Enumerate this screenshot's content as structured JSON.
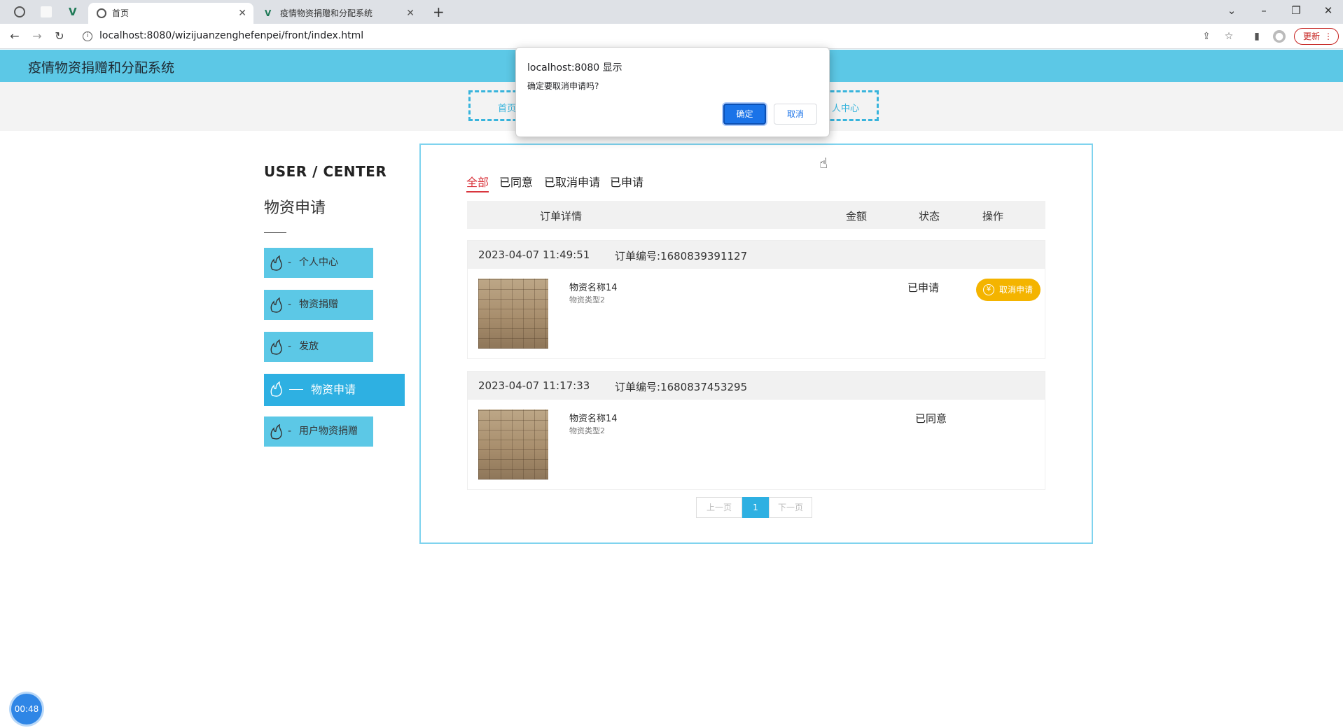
{
  "browser": {
    "tabs": [
      {
        "label": "首页",
        "active": true
      },
      {
        "label": "疫情物资捐赠和分配系统",
        "active": false
      }
    ],
    "url": "localhost:8080/wizijuanzenghefenpei/front/index.html",
    "update_label": "更新"
  },
  "site": {
    "title": "疫情物资捐赠和分配系统",
    "nav_left": "首页",
    "nav_right": "人中心"
  },
  "sidebar": {
    "title": "USER / CENTER",
    "subtitle": "物资申请",
    "items": [
      {
        "label": "个人中心"
      },
      {
        "label": "物资捐赠"
      },
      {
        "label": "发放"
      },
      {
        "label": "物资申请"
      },
      {
        "label": "用户物资捐赠"
      }
    ]
  },
  "filters": [
    "全部",
    "已同意",
    "已取消申请",
    "已申请"
  ],
  "table_headers": {
    "details": "订单详情",
    "amount": "金额",
    "status": "状态",
    "action": "操作"
  },
  "orders": [
    {
      "time": "2023-04-07 11:49:51",
      "order_no": "订单编号:1680839391127",
      "name": "物资名称14",
      "type": "物资类型2",
      "status": "已申请",
      "action": "取消申请"
    },
    {
      "time": "2023-04-07 11:17:33",
      "order_no": "订单编号:1680837453295",
      "name": "物资名称14",
      "type": "物资类型2",
      "status": "已同意"
    }
  ],
  "pagination": {
    "prev": "上一页",
    "current": "1",
    "next": "下一页"
  },
  "dialog": {
    "title": "localhost:8080 显示",
    "message": "确定要取消申请吗?",
    "ok": "确定",
    "cancel": "取消"
  },
  "timer": "00:48",
  "colors": {
    "header": "#5cc8e6",
    "accent": "#2eb0e2",
    "active_filter": "#d9363e",
    "cancel_button": "#f4b400"
  }
}
